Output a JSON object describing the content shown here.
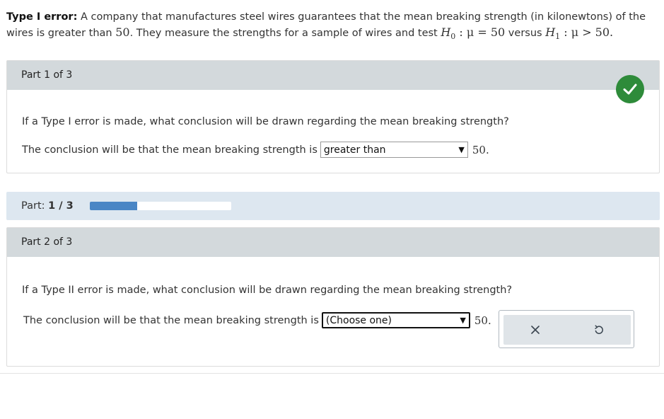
{
  "intro": {
    "label": "Type I error:",
    "text1": " A company that manufactures steel wires guarantees that the mean breaking strength (in kilonewtons) of the wires is greater than ",
    "value": "50",
    "text2": ". They measure the strengths for a sample of wires and test ",
    "h0_sym": "H",
    "h0_sub": "0",
    "h0_rest": " : μ = 50",
    "versus": " versus ",
    "h1_sym": "H",
    "h1_sub": "1",
    "h1_rest": " : μ > 50."
  },
  "part1": {
    "header": "Part 1 of 3",
    "question": "If a Type I error is made, what conclusion will be drawn regarding the mean breaking strength?",
    "answer_prefix": "The conclusion will be that the mean breaking strength is",
    "selected": "greater than",
    "answer_suffix": "50.",
    "status_icon": "checkmark-icon",
    "status_color": "#2e8b3a"
  },
  "progress": {
    "label": "Part:",
    "value": "1 / 3",
    "fraction": 0.333,
    "color": "#4a86c5"
  },
  "part2": {
    "header": "Part 2 of 3",
    "question": "If a Type II error is made, what conclusion will be drawn regarding the mean breaking strength?",
    "answer_prefix": "The conclusion will be that the mean breaking strength is",
    "selected": "(Choose one)",
    "answer_suffix": "50."
  },
  "tools": {
    "clear_icon": "x-icon",
    "undo_icon": "undo-icon"
  }
}
